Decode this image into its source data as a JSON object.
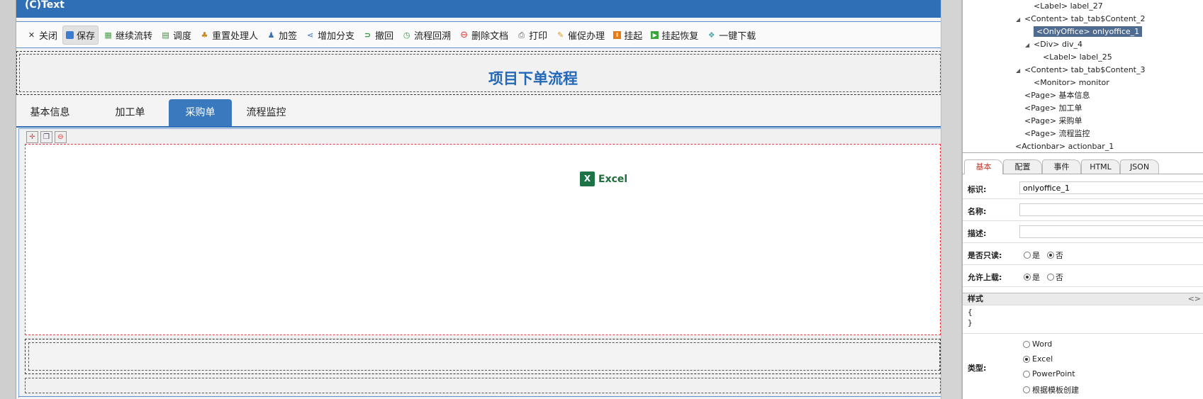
{
  "designer": {
    "title": "(C)Text",
    "toolbar": [
      {
        "label": "关闭",
        "icon": "close-icon"
      },
      {
        "label": "保存",
        "icon": "save-icon",
        "active": true
      },
      {
        "label": "继续流转",
        "icon": "continue-flow-icon"
      },
      {
        "label": "调度",
        "icon": "dispatch-icon"
      },
      {
        "label": "重置处理人",
        "icon": "reset-handler-icon"
      },
      {
        "label": "加签",
        "icon": "add-sign-icon"
      },
      {
        "label": "增加分支",
        "icon": "add-branch-icon"
      },
      {
        "label": "撤回",
        "icon": "withdraw-icon"
      },
      {
        "label": "流程回溯",
        "icon": "flow-trace-icon"
      },
      {
        "label": "删除文档",
        "icon": "delete-doc-icon"
      },
      {
        "label": "打印",
        "icon": "print-icon"
      },
      {
        "label": "催促办理",
        "icon": "urge-icon"
      },
      {
        "label": "挂起",
        "icon": "suspend-icon"
      },
      {
        "label": "挂起恢复",
        "icon": "resume-icon"
      },
      {
        "label": "一键下载",
        "icon": "download-icon"
      }
    ],
    "page_title": "项目下单流程",
    "tabs": [
      {
        "label": "基本信息"
      },
      {
        "label": "加工单"
      },
      {
        "label": "采购单",
        "active": true
      },
      {
        "label": "流程监控"
      }
    ],
    "office_label": "Excel"
  },
  "tree": {
    "rows": [
      {
        "text": "<Label> label_27",
        "indent": 2,
        "arrow": ""
      },
      {
        "text": "<Content> tab_tab$Content_2",
        "indent": 1,
        "arrow": "◢"
      },
      {
        "text": "<OnlyOffice> onlyoffice_1",
        "indent": 2,
        "arrow": "",
        "selected": true
      },
      {
        "text": "<Div> div_4",
        "indent": 2,
        "arrow": "◢"
      },
      {
        "text": "<Label> label_25",
        "indent": 3,
        "arrow": ""
      },
      {
        "text": "<Content> tab_tab$Content_3",
        "indent": 1,
        "arrow": "◢"
      },
      {
        "text": "<Monitor> monitor",
        "indent": 2,
        "arrow": ""
      },
      {
        "text": "<Page> 基本信息",
        "indent": 1,
        "arrow": ""
      },
      {
        "text": "<Page> 加工单",
        "indent": 1,
        "arrow": ""
      },
      {
        "text": "<Page> 采购单",
        "indent": 1,
        "arrow": ""
      },
      {
        "text": "<Page> 流程监控",
        "indent": 1,
        "arrow": ""
      },
      {
        "text": "<Actionbar> actionbar_1",
        "indent": 0,
        "arrow": ""
      }
    ]
  },
  "properties": {
    "tabs": [
      "基本",
      "配置",
      "事件",
      "HTML",
      "JSON"
    ],
    "id_label": "标识:",
    "id_value": "onlyoffice_1",
    "name_label": "名称:",
    "name_value": "",
    "desc_label": "描述:",
    "desc_value": "",
    "readonly_label": "是否只读:",
    "readonly_yes": "是",
    "readonly_no": "否",
    "upload_label": "允许上载:",
    "upload_yes": "是",
    "upload_no": "否",
    "style_label": "样式",
    "style_expand": "<>",
    "style_open": "{",
    "style_close": "}",
    "type_label": "类型:",
    "type_options": [
      "Word",
      "Excel",
      "PowerPoint",
      "根据模板创建"
    ],
    "type_selected": "Excel"
  }
}
